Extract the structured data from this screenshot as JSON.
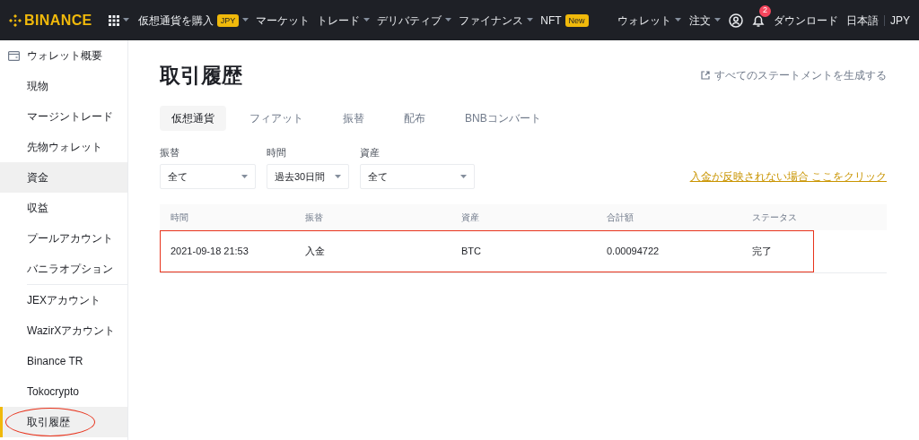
{
  "nav": {
    "logo": "BINANCE",
    "menus": [
      {
        "label": "仮想通貨を購入",
        "badge": "JPY",
        "caret": true
      },
      {
        "label": "マーケット",
        "caret": false
      },
      {
        "label": "トレード",
        "caret": true
      },
      {
        "label": "デリバティブ",
        "caret": true
      },
      {
        "label": "ファイナンス",
        "caret": true
      },
      {
        "label": "NFT",
        "badge": "New",
        "caret": false
      }
    ],
    "right_menus": [
      {
        "label": "ウォレット",
        "caret": true
      },
      {
        "label": "注文",
        "caret": true
      }
    ],
    "notification_count": "2",
    "download": "ダウンロード",
    "language": "日本語",
    "currency": "JPY"
  },
  "sidebar": {
    "header": "ウォレット概要",
    "sections": [
      [
        {
          "label": "現物",
          "selected": false,
          "hovered": false,
          "circled": false
        },
        {
          "label": "マージントレード",
          "selected": false,
          "hovered": false,
          "circled": false
        },
        {
          "label": "先物ウォレット",
          "selected": false,
          "hovered": false,
          "circled": false
        },
        {
          "label": "資金",
          "selected": false,
          "hovered": true,
          "circled": false
        },
        {
          "label": "収益",
          "selected": false,
          "hovered": false,
          "circled": false
        },
        {
          "label": "プールアカウント",
          "selected": false,
          "hovered": false,
          "circled": false
        },
        {
          "label": "バニラオプション",
          "selected": false,
          "hovered": false,
          "circled": false
        }
      ],
      [
        {
          "label": "JEXアカウント",
          "selected": false,
          "hovered": false,
          "circled": false
        },
        {
          "label": "WazirXアカウント",
          "selected": false,
          "hovered": false,
          "circled": false
        },
        {
          "label": "Binance TR",
          "selected": false,
          "hovered": false,
          "circled": false
        },
        {
          "label": "Tokocrypto",
          "selected": false,
          "hovered": false,
          "circled": false
        },
        {
          "label": "取引履歴",
          "selected": true,
          "hovered": false,
          "circled": true
        }
      ]
    ]
  },
  "page": {
    "title": "取引履歴",
    "statement_link": "すべてのステートメントを生成する",
    "tabs": [
      {
        "label": "仮想通貨",
        "selected": true
      },
      {
        "label": "フィアット",
        "selected": false
      },
      {
        "label": "振替",
        "selected": false
      },
      {
        "label": "配布",
        "selected": false
      },
      {
        "label": "BNBコンバート",
        "selected": false
      }
    ],
    "filters": [
      {
        "label": "振替",
        "value": "全て"
      },
      {
        "label": "時間",
        "value": "過去30日間"
      },
      {
        "label": "資産",
        "value": "全て"
      }
    ],
    "help_link": "入金が反映されない場合 ここをクリック",
    "table": {
      "columns": [
        "時間",
        "振替",
        "資産",
        "合計額",
        "ステータス"
      ],
      "rows": [
        {
          "cells": [
            "2021-09-18 21:53",
            "入金",
            "BTC",
            "0.00094722",
            "完了"
          ],
          "boxed": true
        }
      ]
    }
  }
}
